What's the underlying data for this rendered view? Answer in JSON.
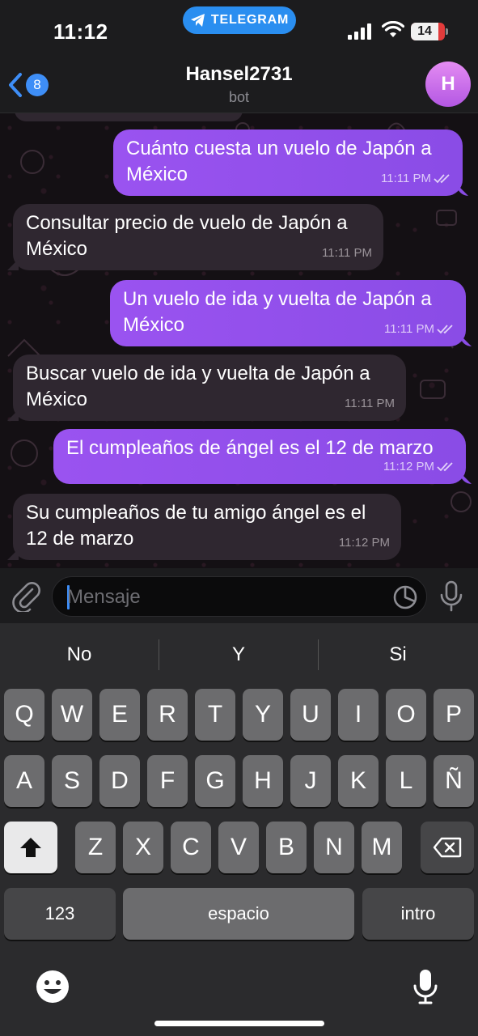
{
  "status_bar": {
    "time": "11:12",
    "app_pill": "TELEGRAM",
    "battery": "14",
    "signal_icon": "cellular-signal-icon",
    "wifi_icon": "wifi-icon"
  },
  "header": {
    "back_badge": "8",
    "title": "Hansel2731",
    "subtitle": "bot",
    "avatar_letter": "H"
  },
  "messages": [
    {
      "direction": "out",
      "text": "Cuánto cuesta un vuelo de Japón a México",
      "time": "11:11 PM",
      "read": true
    },
    {
      "direction": "in",
      "text": "Consultar precio de vuelo de Japón a México",
      "time": "11:11 PM"
    },
    {
      "direction": "out",
      "text": "Un vuelo de ida y vuelta de Japón a México",
      "time": "11:11 PM",
      "read": true
    },
    {
      "direction": "in",
      "text": "Buscar vuelo de ida y vuelta de Japón a México",
      "time": "11:11 PM"
    },
    {
      "direction": "out",
      "text": "El cumpleaños de ángel es el 12 de marzo",
      "time": "11:12 PM",
      "read": true
    },
    {
      "direction": "in",
      "text": "Su cumpleaños de tu amigo ángel es el 12 de marzo",
      "time": "11:12 PM"
    }
  ],
  "composer": {
    "placeholder": "Mensaje",
    "value": ""
  },
  "keyboard": {
    "suggestions": [
      "No",
      "Y",
      "Si"
    ],
    "row1": [
      "Q",
      "W",
      "E",
      "R",
      "T",
      "Y",
      "U",
      "I",
      "O",
      "P"
    ],
    "row2": [
      "A",
      "S",
      "D",
      "F",
      "G",
      "H",
      "J",
      "K",
      "L",
      "Ñ"
    ],
    "row3": [
      "Z",
      "X",
      "C",
      "V",
      "B",
      "N",
      "M"
    ],
    "numbers_label": "123",
    "space_label": "espacio",
    "return_label": "intro"
  },
  "colors": {
    "outgoing_bubble": "#8c4ee9",
    "incoming_bubble": "#2f2730",
    "accent_blue": "#3e8ef7"
  }
}
